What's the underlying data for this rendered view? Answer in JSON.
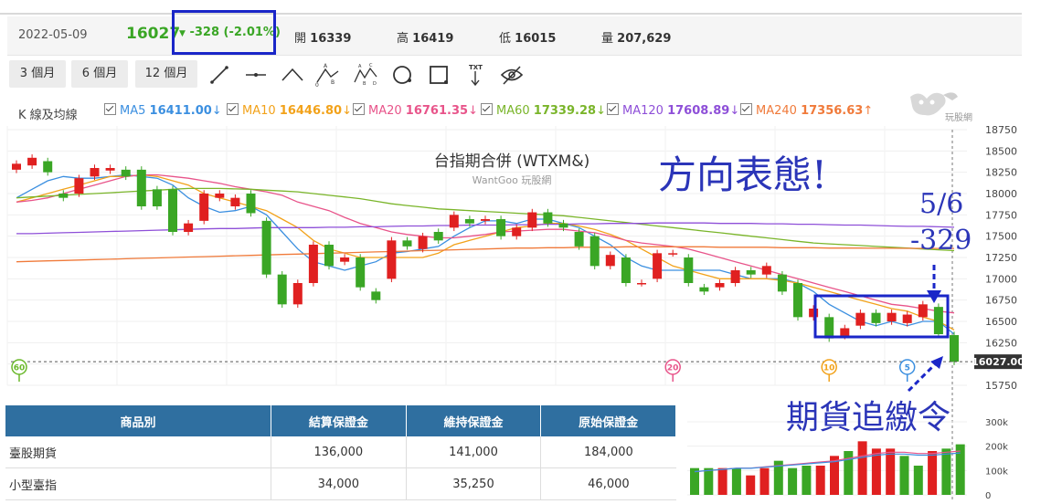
{
  "header": {
    "date": "2022-05-09",
    "price": "16027",
    "change": "-328 (-2.01%)",
    "open_label": "開",
    "open": "16339",
    "high_label": "高",
    "high": "16419",
    "low_label": "低",
    "low": "16015",
    "volume_label": "量",
    "volume": "207,629"
  },
  "toolbar": {
    "range_buttons": [
      "3 個月",
      "6 個月",
      "12 個月"
    ],
    "tools": [
      "line-tool-icon",
      "horizontal-line-icon",
      "peak-line-icon",
      "abc-pattern-icon",
      "abcd-pattern-icon",
      "ellipse-tool-icon",
      "rectangle-tool-icon",
      "text-tool-icon",
      "hide-eye-icon"
    ],
    "tool_text_label": "TXT"
  },
  "ma": {
    "title": "K 線及均線",
    "items": [
      {
        "name": "MA5",
        "value": "16411.00",
        "arrow": "↓",
        "color": "#3b8fe0"
      },
      {
        "name": "MA10",
        "value": "16446.80",
        "arrow": "↓",
        "color": "#f2a21a"
      },
      {
        "name": "MA20",
        "value": "16761.35",
        "arrow": "↓",
        "color": "#e8548a"
      },
      {
        "name": "MA60",
        "value": "17339.28",
        "arrow": "↓",
        "color": "#7ab52a"
      },
      {
        "name": "MA120",
        "value": "17608.89",
        "arrow": "↓",
        "color": "#8e4fd8"
      },
      {
        "name": "MA240",
        "value": "17356.63",
        "arrow": "↑",
        "color": "#f07a3a"
      }
    ]
  },
  "logo": {
    "text": "玩股網"
  },
  "chart_data": {
    "type": "candlestick",
    "title": "台指期合併 (WTXM&)",
    "subtitle": "WantGoo 玩股網",
    "ylim": [
      15750,
      18750
    ],
    "y_ticks": [
      "18750",
      "18500",
      "18250",
      "18000",
      "17750",
      "17500",
      "17250",
      "17000",
      "16750",
      "16500",
      "16250",
      "16000",
      "15750"
    ],
    "last_price_label": "16027.00",
    "ref_line": 16027,
    "period_markers": [
      "60",
      "20",
      "10",
      "5"
    ],
    "candles": [
      {
        "o": 18280,
        "c": 18350
      },
      {
        "o": 18330,
        "c": 18420
      },
      {
        "o": 18380,
        "c": 18250
      },
      {
        "o": 18000,
        "c": 17950
      },
      {
        "o": 18000,
        "c": 18180
      },
      {
        "o": 18200,
        "c": 18300
      },
      {
        "o": 18270,
        "c": 18300
      },
      {
        "o": 18280,
        "c": 18200
      },
      {
        "o": 18280,
        "c": 17850
      },
      {
        "o": 18050,
        "c": 17850
      },
      {
        "o": 18050,
        "c": 17550
      },
      {
        "o": 17550,
        "c": 17650
      },
      {
        "o": 17680,
        "c": 18000
      },
      {
        "o": 17950,
        "c": 18000
      },
      {
        "o": 17850,
        "c": 17950
      },
      {
        "o": 18000,
        "c": 17770
      },
      {
        "o": 17680,
        "c": 17050
      },
      {
        "o": 17050,
        "c": 16700
      },
      {
        "o": 16700,
        "c": 16950
      },
      {
        "o": 16950,
        "c": 17400
      },
      {
        "o": 17400,
        "c": 17150
      },
      {
        "o": 17200,
        "c": 17250
      },
      {
        "o": 17250,
        "c": 16900
      },
      {
        "o": 16850,
        "c": 16750
      },
      {
        "o": 17000,
        "c": 17450
      },
      {
        "o": 17450,
        "c": 17380
      },
      {
        "o": 17350,
        "c": 17500
      },
      {
        "o": 17550,
        "c": 17450
      },
      {
        "o": 17600,
        "c": 17750
      },
      {
        "o": 17700,
        "c": 17650
      },
      {
        "o": 17680,
        "c": 17700
      },
      {
        "o": 17700,
        "c": 17500
      },
      {
        "o": 17500,
        "c": 17600
      },
      {
        "o": 17600,
        "c": 17780
      },
      {
        "o": 17780,
        "c": 17650
      },
      {
        "o": 17650,
        "c": 17600
      },
      {
        "o": 17550,
        "c": 17380
      },
      {
        "o": 17500,
        "c": 17150
      },
      {
        "o": 17150,
        "c": 17280
      },
      {
        "o": 17250,
        "c": 16950
      },
      {
        "o": 16950,
        "c": 16950
      },
      {
        "o": 17000,
        "c": 17300
      },
      {
        "o": 17300,
        "c": 17300
      },
      {
        "o": 17250,
        "c": 16950
      },
      {
        "o": 16900,
        "c": 16850
      },
      {
        "o": 16900,
        "c": 16950
      },
      {
        "o": 16950,
        "c": 17100
      },
      {
        "o": 17100,
        "c": 17050
      },
      {
        "o": 17050,
        "c": 17150
      },
      {
        "o": 17050,
        "c": 16850
      },
      {
        "o": 16950,
        "c": 16550
      },
      {
        "o": 16550,
        "c": 16650
      },
      {
        "o": 16550,
        "c": 16300
      },
      {
        "o": 16330,
        "c": 16420
      },
      {
        "o": 16450,
        "c": 16600
      },
      {
        "o": 16600,
        "c": 16480
      },
      {
        "o": 16500,
        "c": 16600
      },
      {
        "o": 16480,
        "c": 16580
      },
      {
        "o": 16550,
        "c": 16700
      },
      {
        "o": 16670,
        "c": 16350
      },
      {
        "o": 16339,
        "c": 16027
      }
    ],
    "ma_lines": [
      {
        "name": "MA5",
        "color": "#3b8fe0",
        "values": [
          17950,
          18050,
          18150,
          18200,
          18180,
          18180,
          18200,
          18220,
          18200,
          18180,
          18100,
          17950,
          17850,
          17780,
          17800,
          17850,
          17750,
          17550,
          17350,
          17200,
          17150,
          17100,
          17150,
          17200,
          17300,
          17320,
          17350,
          17380,
          17500,
          17600,
          17680,
          17680,
          17650,
          17700,
          17700,
          17650,
          17600,
          17500,
          17400,
          17250,
          17150,
          17100,
          17100,
          17100,
          17100,
          17100,
          17050,
          17000,
          17000,
          17000,
          16950,
          16850,
          16700,
          16600,
          16500,
          16450,
          16500,
          16450,
          16500,
          16500,
          16350
        ]
      },
      {
        "name": "MA10",
        "color": "#f2a21a",
        "values": [
          17900,
          17950,
          18000,
          18050,
          18100,
          18150,
          18200,
          18200,
          18220,
          18200,
          18150,
          18100,
          18000,
          17950,
          17900,
          17850,
          17800,
          17700,
          17600,
          17450,
          17350,
          17300,
          17250,
          17250,
          17250,
          17250,
          17250,
          17300,
          17400,
          17450,
          17500,
          17550,
          17600,
          17620,
          17650,
          17650,
          17620,
          17580,
          17520,
          17450,
          17350,
          17250,
          17150,
          17100,
          17050,
          17000,
          17000,
          17000,
          17000,
          16980,
          16950,
          16900,
          16850,
          16800,
          16750,
          16700,
          16650,
          16620,
          16550,
          16500,
          16400
        ]
      },
      {
        "name": "MA20",
        "color": "#e8548a",
        "values": [
          17900,
          17920,
          17950,
          18000,
          18050,
          18100,
          18150,
          18200,
          18220,
          18220,
          18200,
          18180,
          18150,
          18120,
          18080,
          18050,
          18020,
          17980,
          17900,
          17850,
          17800,
          17720,
          17650,
          17600,
          17550,
          17520,
          17500,
          17480,
          17480,
          17500,
          17520,
          17550,
          17560,
          17570,
          17580,
          17580,
          17560,
          17540,
          17500,
          17450,
          17420,
          17400,
          17380,
          17350,
          17300,
          17250,
          17200,
          17150,
          17100,
          17050,
          17000,
          16950,
          16900,
          16850,
          16800,
          16750,
          16700,
          16680,
          16650,
          16620,
          16600
        ]
      },
      {
        "name": "MA60",
        "color": "#7ab52a",
        "values": [
          17950,
          17960,
          17970,
          17980,
          17990,
          18000,
          18010,
          18020,
          18030,
          18040,
          18050,
          18060,
          18060,
          18060,
          18055,
          18050,
          18040,
          18030,
          18020,
          18000,
          17980,
          17960,
          17940,
          17910,
          17880,
          17860,
          17840,
          17820,
          17810,
          17800,
          17790,
          17780,
          17770,
          17760,
          17750,
          17740,
          17720,
          17700,
          17680,
          17660,
          17640,
          17620,
          17600,
          17580,
          17560,
          17540,
          17520,
          17500,
          17480,
          17460,
          17440,
          17420,
          17410,
          17400,
          17390,
          17380,
          17370,
          17360,
          17350,
          17340,
          17330
        ]
      },
      {
        "name": "MA120",
        "color": "#8e4fd8",
        "values": [
          17530,
          17530,
          17535,
          17540,
          17545,
          17550,
          17555,
          17560,
          17565,
          17570,
          17575,
          17580,
          17585,
          17590,
          17590,
          17595,
          17600,
          17600,
          17600,
          17600,
          17605,
          17605,
          17610,
          17610,
          17615,
          17620,
          17620,
          17625,
          17625,
          17630,
          17630,
          17630,
          17635,
          17635,
          17640,
          17640,
          17645,
          17645,
          17650,
          17650,
          17650,
          17655,
          17655,
          17655,
          17655,
          17650,
          17650,
          17650,
          17645,
          17645,
          17640,
          17640,
          17635,
          17630,
          17630,
          17625,
          17620,
          17615,
          17615,
          17610,
          17605
        ]
      },
      {
        "name": "MA240",
        "color": "#f07a3a",
        "values": [
          17200,
          17205,
          17210,
          17215,
          17220,
          17225,
          17230,
          17235,
          17240,
          17245,
          17250,
          17255,
          17260,
          17265,
          17270,
          17275,
          17280,
          17285,
          17290,
          17295,
          17300,
          17305,
          17310,
          17315,
          17320,
          17325,
          17330,
          17335,
          17340,
          17345,
          17350,
          17355,
          17360,
          17360,
          17365,
          17365,
          17370,
          17370,
          17370,
          17375,
          17375,
          17375,
          17375,
          17375,
          17375,
          17370,
          17370,
          17370,
          17370,
          17365,
          17365,
          17365,
          17360,
          17360,
          17360,
          17358,
          17358,
          17357,
          17357,
          17356,
          17356
        ]
      }
    ],
    "volume": {
      "ylim": [
        0,
        300000
      ],
      "y_ticks": [
        "300k",
        "200k",
        "100k",
        "0"
      ],
      "values": [
        110000,
        110000,
        110000,
        110000,
        80000,
        110000,
        140000,
        110000,
        120000,
        120000,
        160000,
        180000,
        220000,
        190000,
        190000,
        160000,
        120000,
        180000,
        190000,
        207629
      ],
      "colors": [
        "#3aa625",
        "#3aa625",
        "#e02020",
        "#3aa625",
        "#e02020",
        "#e02020",
        "#3aa625",
        "#3aa625",
        "#3aa625",
        "#e02020",
        "#e02020",
        "#3aa625",
        "#e02020",
        "#e02020",
        "#e02020",
        "#3aa625",
        "#3aa625",
        "#e02020",
        "#3aa625",
        "#3aa625"
      ],
      "ma_values": [
        95000,
        100000,
        105000,
        110000,
        110000,
        115000,
        120000,
        125000,
        130000,
        135000,
        140000,
        150000,
        160000,
        170000,
        175000,
        175000,
        170000,
        170000,
        175000,
        180000
      ]
    }
  },
  "annotations": {
    "direction": "方向表態!",
    "date_note": "5/6",
    "change_note": "-329",
    "margin_call": "期貨追繳令"
  },
  "margin_table": {
    "headers": [
      "商品別",
      "結算保證金",
      "維持保證金",
      "原始保證金"
    ],
    "rows": [
      [
        "臺股期貨",
        "136,000",
        "141,000",
        "184,000"
      ],
      [
        "小型臺指",
        "34,000",
        "35,250",
        "46,000"
      ]
    ]
  }
}
